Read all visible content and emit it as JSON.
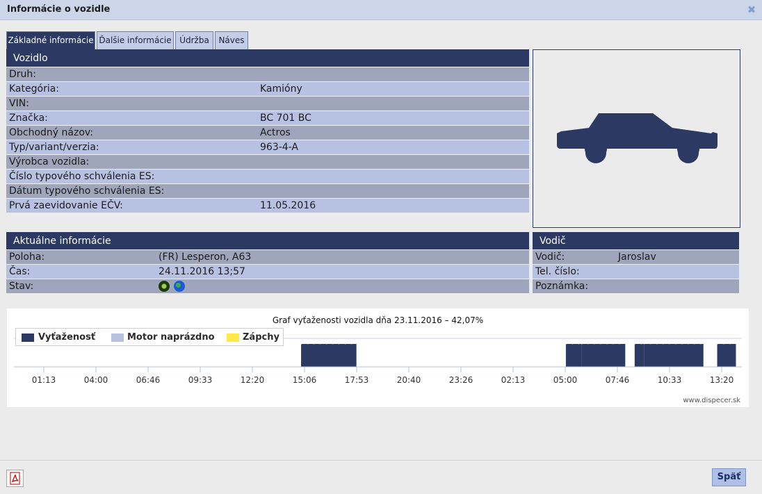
{
  "window": {
    "title": "Informácie o vozidle"
  },
  "tabs": [
    {
      "label": "Základné informácie"
    },
    {
      "label": "Ďalšie informácie"
    },
    {
      "label": "Údržba"
    },
    {
      "label": "Náves"
    }
  ],
  "vehicle": {
    "header": "Vozidlo",
    "rows": [
      {
        "label": "Druh:",
        "value": ""
      },
      {
        "label": "Kategória:",
        "value": "Kamióny"
      },
      {
        "label": "VIN:",
        "value": ""
      },
      {
        "label": "Značka:",
        "value": "BC 701 BC"
      },
      {
        "label": "Obchodný názov:",
        "value": "Actros"
      },
      {
        "label": "Typ/variant/verzia:",
        "value": "963-4-A"
      },
      {
        "label": "Výrobca vozidla:",
        "value": ""
      },
      {
        "label": "Číslo typového schválenia ES:",
        "value": ""
      },
      {
        "label": "Dátum typového schválenia ES:",
        "value": ""
      },
      {
        "label": "Prvá zaevidovanie EČV:",
        "value": "11.05.2016"
      }
    ]
  },
  "current": {
    "header": "Aktuálne informácie",
    "rows": [
      {
        "label": "Poloha:",
        "value": "(FR) Lesperon, A63"
      },
      {
        "label": "Čas:",
        "value": "24.11.2016 13;57"
      },
      {
        "label": "Stav:",
        "value": ""
      }
    ],
    "status_icons": [
      "engine-status-icon",
      "gps-globe-icon"
    ]
  },
  "driver": {
    "header": "Vodič",
    "rows": [
      {
        "label": "Vodič:",
        "value": "Jaroslav"
      },
      {
        "label": "Tel. číslo:",
        "value": ""
      },
      {
        "label": "Poznámka:",
        "value": ""
      }
    ]
  },
  "chart_data": {
    "type": "area",
    "title": "Graf vyťaženosti vozidla dňa 23.11.2016 – 42,07%",
    "legend": [
      {
        "name": "Vyťaženosť",
        "color": "#2c3962"
      },
      {
        "name": "Motor naprázdno",
        "color": "#b7c2e2"
      },
      {
        "name": "Zápchy",
        "color": "#ffe94a"
      }
    ],
    "legend_position": "top-left",
    "x_ticks": [
      "01:13",
      "04:00",
      "06:46",
      "09:33",
      "12:20",
      "15:06",
      "17:53",
      "20:40",
      "23:26",
      "02:13",
      "05:00",
      "07:46",
      "10:33",
      "13:20"
    ],
    "series": [
      {
        "name": "Vyťaženosť",
        "color": "#2c3962",
        "intervals": [
          {
            "start": "14:56",
            "end": "17:53"
          },
          {
            "start": "05:03",
            "end": "05:53"
          },
          {
            "start": "05:53",
            "end": "08:13"
          },
          {
            "start": "08:43",
            "end": "09:13"
          },
          {
            "start": "09:13",
            "end": "12:23"
          },
          {
            "start": "13:07",
            "end": "14:07"
          }
        ]
      }
    ],
    "credit": "www.dispecer.sk"
  },
  "footer": {
    "back_label": "Späť",
    "pdf_icon": "pdf-icon"
  }
}
